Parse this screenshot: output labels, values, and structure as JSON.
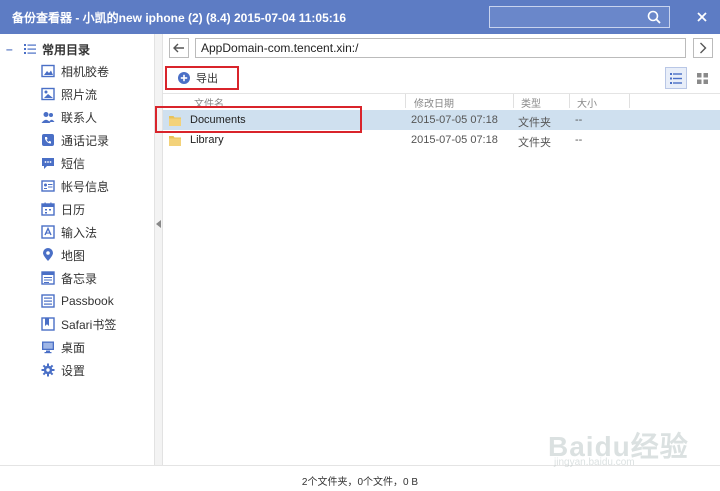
{
  "window": {
    "title": "备份查看器 - 小凯的new iphone (2) (8.4) 2015-07-04 11:05:16",
    "search_placeholder": "",
    "close_icon": "close-icon",
    "search_icon": "search-icon"
  },
  "sidebar": {
    "group_label": "常用目录",
    "items": [
      {
        "label": "相机胶卷",
        "icon": "camera-roll-icon"
      },
      {
        "label": "照片流",
        "icon": "photo-stream-icon"
      },
      {
        "label": "联系人",
        "icon": "contacts-icon"
      },
      {
        "label": "通话记录",
        "icon": "call-log-icon"
      },
      {
        "label": "短信",
        "icon": "sms-icon"
      },
      {
        "label": "帐号信息",
        "icon": "account-info-icon"
      },
      {
        "label": "日历",
        "icon": "calendar-icon"
      },
      {
        "label": "输入法",
        "icon": "input-method-icon"
      },
      {
        "label": "地图",
        "icon": "map-pin-icon"
      },
      {
        "label": "备忘录",
        "icon": "notes-icon"
      },
      {
        "label": "Passbook",
        "icon": "passbook-icon"
      },
      {
        "label": "Safari书签",
        "icon": "bookmark-icon"
      },
      {
        "label": "桌面",
        "icon": "desktop-icon"
      },
      {
        "label": "设置",
        "icon": "gear-icon"
      }
    ]
  },
  "nav": {
    "path": "AppDomain-com.tencent.xin:/"
  },
  "toolbar": {
    "export_label": "导出"
  },
  "table": {
    "columns": [
      "文件名",
      "修改日期",
      "类型",
      "大小"
    ],
    "rows": [
      {
        "name": "Documents",
        "date": "2015-07-05 07:18",
        "type": "文件夹",
        "size": "--",
        "selected": true
      },
      {
        "name": "Library",
        "date": "2015-07-05 07:18",
        "type": "文件夹",
        "size": "--",
        "selected": false
      }
    ]
  },
  "status": {
    "text": "2个文件夹，0个文件，0 B"
  },
  "watermark": {
    "brand": "Baidu经验",
    "sub": "jingyan.baidu.com"
  },
  "colors": {
    "titlebar": "#5d7cc4",
    "accent": "#4a6fc6",
    "highlight": "#d9242b",
    "selection": "#cfe0ef"
  }
}
